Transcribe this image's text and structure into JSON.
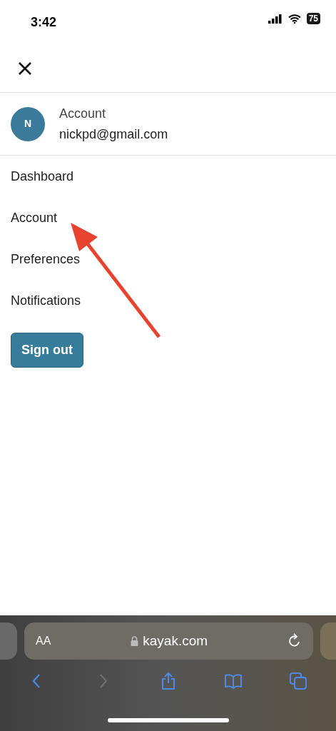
{
  "status_bar": {
    "time": "3:42",
    "battery": "75"
  },
  "account": {
    "avatar": "N",
    "label": "Account",
    "email": "nickpd@gmail.com"
  },
  "menu": [
    {
      "label": "Dashboard"
    },
    {
      "label": "Account"
    },
    {
      "label": "Preferences"
    },
    {
      "label": "Notifications"
    }
  ],
  "sign_out": "Sign out",
  "address_bar": {
    "text_size": "AA",
    "url": "kayak.com"
  },
  "toolbar": [
    {
      "kind": "back",
      "disabled": false
    },
    {
      "kind": "forward",
      "disabled": true
    },
    {
      "kind": "share",
      "disabled": false
    },
    {
      "kind": "bookmarks",
      "disabled": false
    },
    {
      "kind": "tabs",
      "disabled": false
    }
  ]
}
